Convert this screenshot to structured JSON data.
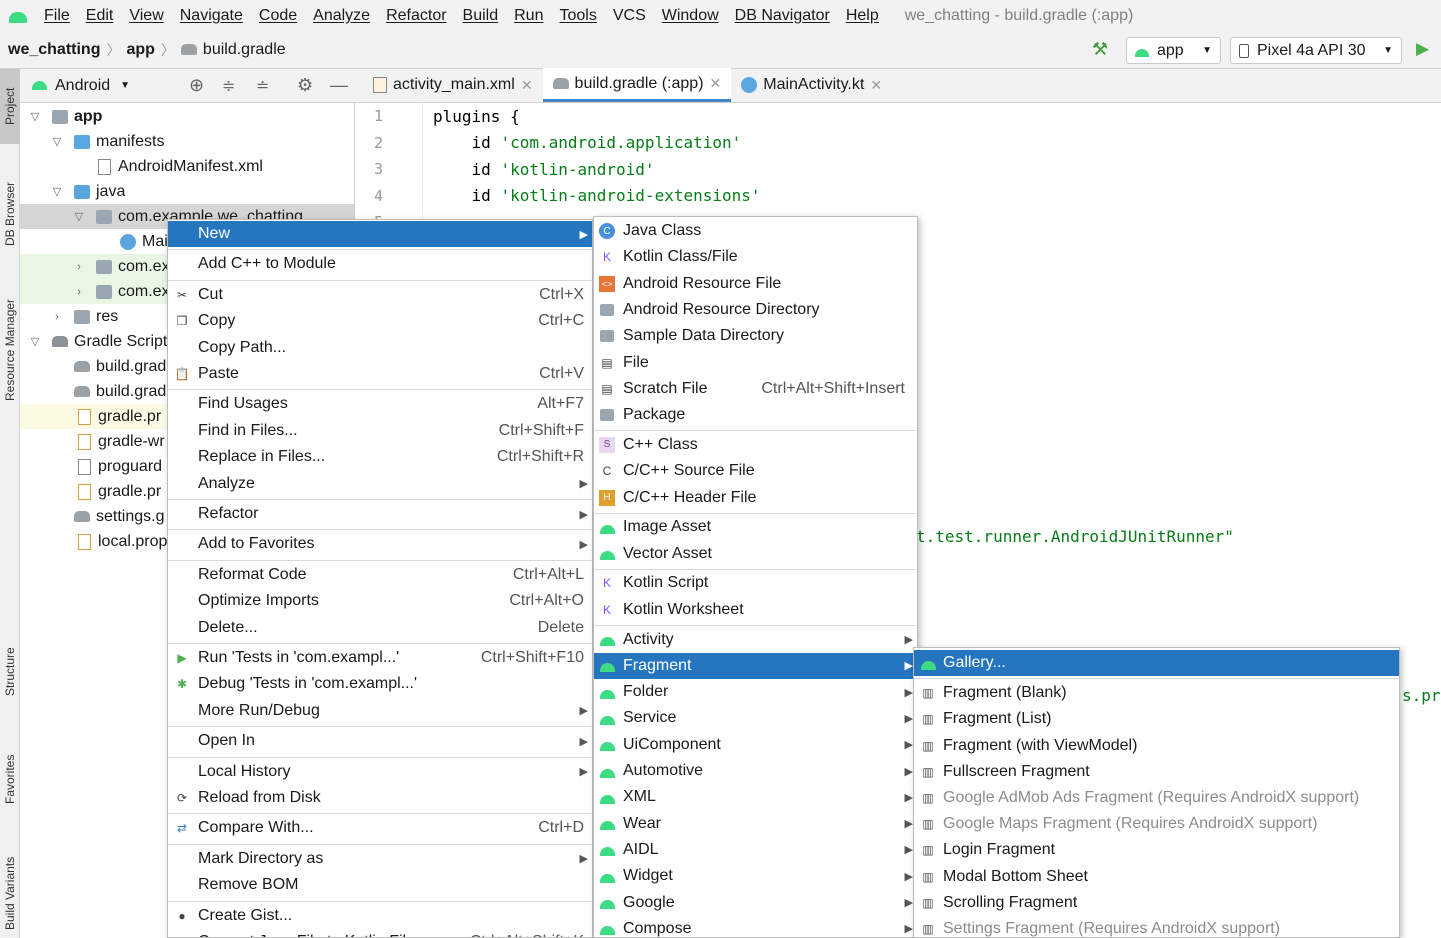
{
  "menubar": {
    "items": [
      "File",
      "Edit",
      "View",
      "Navigate",
      "Code",
      "Analyze",
      "Refactor",
      "Build",
      "Run",
      "Tools",
      "VCS",
      "Window",
      "DB Navigator",
      "Help"
    ],
    "window_title": "we_chatting - build.gradle (:app)"
  },
  "navbar": {
    "project": "we_chatting",
    "module": "app",
    "file": "build.gradle",
    "run_config": "app",
    "device": "Pixel 4a API 30"
  },
  "left_tool_windows": [
    "Project",
    "DB Browser",
    "Resource Manager",
    "Structure",
    "Favorites",
    "Build Variants"
  ],
  "project_panel": {
    "view_selector": "Android",
    "tree": [
      {
        "label": "app",
        "depth": 0,
        "arrow": "down",
        "bold": true
      },
      {
        "label": "manifests",
        "depth": 1,
        "arrow": "down"
      },
      {
        "label": "AndroidManifest.xml",
        "depth": 2,
        "arrow": ""
      },
      {
        "label": "java",
        "depth": 1,
        "arrow": "down"
      },
      {
        "label": "com.example.we_chatting",
        "depth": 2,
        "arrow": "down"
      },
      {
        "label": "Mai",
        "depth": 3,
        "arrow": ""
      },
      {
        "label": "com.ex",
        "depth": 2,
        "arrow": "right"
      },
      {
        "label": "com.ex",
        "depth": 2,
        "arrow": "right"
      },
      {
        "label": "res",
        "depth": 1,
        "arrow": "right"
      },
      {
        "label": "Gradle Script",
        "depth": 0,
        "arrow": "down"
      },
      {
        "label": "build.grad",
        "depth": 1,
        "arrow": ""
      },
      {
        "label": "build.grad",
        "depth": 1,
        "arrow": ""
      },
      {
        "label": "gradle.pr",
        "depth": 1,
        "arrow": ""
      },
      {
        "label": "gradle-wr",
        "depth": 1,
        "arrow": ""
      },
      {
        "label": "proguard",
        "depth": 1,
        "arrow": ""
      },
      {
        "label": "gradle.pr",
        "depth": 1,
        "arrow": ""
      },
      {
        "label": "settings.g",
        "depth": 1,
        "arrow": ""
      },
      {
        "label": "local.prop",
        "depth": 1,
        "arrow": ""
      }
    ]
  },
  "editor": {
    "tabs": [
      "activity_main.xml",
      "build.gradle (:app)",
      "MainActivity.kt"
    ],
    "active_tab": 1,
    "line_numbers": [
      "1",
      "2",
      "3",
      "4",
      "5"
    ],
    "lines": [
      {
        "kw": "plugins {",
        "str": ""
      },
      {
        "kw": "    id ",
        "str": "'com.android.application'"
      },
      {
        "kw": "    id ",
        "str": "'kotlin-android'"
      },
      {
        "kw": "    id ",
        "str": "'kotlin-android-extensions'"
      }
    ],
    "visible_fragment_1": "t.test.runner.AndroidJUnitRunner\"",
    "visible_fragment_2": "s.pr"
  },
  "context_menu": [
    {
      "label": "New",
      "submenu": true,
      "selected": true
    },
    {
      "sep": true
    },
    {
      "label": "Add C++ to Module"
    },
    {
      "sep": true
    },
    {
      "label": "Cut",
      "shortcut": "Ctrl+X",
      "icon": "scissors-icon"
    },
    {
      "label": "Copy",
      "shortcut": "Ctrl+C",
      "icon": "copy-icon"
    },
    {
      "label": "Copy Path..."
    },
    {
      "label": "Paste",
      "shortcut": "Ctrl+V",
      "icon": "paste-icon"
    },
    {
      "sep": true
    },
    {
      "label": "Find Usages",
      "shortcut": "Alt+F7"
    },
    {
      "label": "Find in Files...",
      "shortcut": "Ctrl+Shift+F"
    },
    {
      "label": "Replace in Files...",
      "shortcut": "Ctrl+Shift+R"
    },
    {
      "label": "Analyze",
      "submenu": true
    },
    {
      "sep": true
    },
    {
      "label": "Refactor",
      "submenu": true
    },
    {
      "sep": true
    },
    {
      "label": "Add to Favorites",
      "submenu": true
    },
    {
      "sep": true
    },
    {
      "label": "Reformat Code",
      "shortcut": "Ctrl+Alt+L"
    },
    {
      "label": "Optimize Imports",
      "shortcut": "Ctrl+Alt+O"
    },
    {
      "label": "Delete...",
      "shortcut": "Delete"
    },
    {
      "sep": true
    },
    {
      "label": "Run 'Tests in 'com.exampl...'",
      "shortcut": "Ctrl+Shift+F10",
      "icon": "run-icon"
    },
    {
      "label": "Debug 'Tests in 'com.exampl...'",
      "icon": "debug-icon"
    },
    {
      "label": "More Run/Debug",
      "submenu": true
    },
    {
      "sep": true
    },
    {
      "label": "Open In",
      "submenu": true
    },
    {
      "sep": true
    },
    {
      "label": "Local History",
      "submenu": true
    },
    {
      "label": "Reload from Disk",
      "icon": "reload-icon"
    },
    {
      "sep": true
    },
    {
      "label": "Compare With...",
      "shortcut": "Ctrl+D",
      "icon": "compare-icon"
    },
    {
      "sep": true
    },
    {
      "label": "Mark Directory as",
      "submenu": true
    },
    {
      "label": "Remove BOM"
    },
    {
      "sep": true
    },
    {
      "label": "Create Gist...",
      "icon": "github-icon"
    },
    {
      "label": "Convert Java File to Kotlin File",
      "shortcut": "Ctrl+Alt+Shift+K"
    }
  ],
  "new_submenu": [
    {
      "label": "Java Class",
      "icon": "java-class-icon"
    },
    {
      "label": "Kotlin Class/File",
      "icon": "kotlin-icon"
    },
    {
      "label": "Android Resource File",
      "icon": "android-resource-file-icon"
    },
    {
      "label": "Android Resource Directory",
      "icon": "folder-icon"
    },
    {
      "label": "Sample Data Directory",
      "icon": "folder-icon"
    },
    {
      "label": "File",
      "icon": "file-icon"
    },
    {
      "label": "Scratch File",
      "shortcut": "Ctrl+Alt+Shift+Insert",
      "icon": "scratch-file-icon"
    },
    {
      "label": "Package",
      "icon": "package-icon"
    },
    {
      "sep": true
    },
    {
      "label": "C++ Class",
      "icon": "cpp-class-icon"
    },
    {
      "label": "C/C++ Source File",
      "icon": "cpp-source-icon"
    },
    {
      "label": "C/C++ Header File",
      "icon": "cpp-header-icon"
    },
    {
      "sep": true
    },
    {
      "label": "Image Asset",
      "icon": "android-icon"
    },
    {
      "label": "Vector Asset",
      "icon": "android-icon"
    },
    {
      "sep": true
    },
    {
      "label": "Kotlin Script",
      "icon": "kotlin-script-icon"
    },
    {
      "label": "Kotlin Worksheet",
      "icon": "kotlin-script-icon"
    },
    {
      "sep": true
    },
    {
      "label": "Activity",
      "submenu": true,
      "icon": "android-icon"
    },
    {
      "label": "Fragment",
      "submenu": true,
      "selected": true,
      "icon": "android-icon"
    },
    {
      "label": "Folder",
      "submenu": true,
      "icon": "android-icon"
    },
    {
      "label": "Service",
      "submenu": true,
      "icon": "android-icon"
    },
    {
      "label": "UiComponent",
      "submenu": true,
      "icon": "android-icon"
    },
    {
      "label": "Automotive",
      "submenu": true,
      "icon": "android-icon"
    },
    {
      "label": "XML",
      "submenu": true,
      "icon": "android-icon"
    },
    {
      "label": "Wear",
      "submenu": true,
      "icon": "android-icon"
    },
    {
      "label": "AIDL",
      "submenu": true,
      "icon": "android-icon"
    },
    {
      "label": "Widget",
      "submenu": true,
      "icon": "android-icon"
    },
    {
      "label": "Google",
      "submenu": true,
      "icon": "android-icon"
    },
    {
      "label": "Compose",
      "submenu": true,
      "icon": "android-icon"
    }
  ],
  "fragment_submenu": [
    {
      "label": "Gallery...",
      "selected": true,
      "icon": "android-icon"
    },
    {
      "sep": true
    },
    {
      "label": "Fragment (Blank)",
      "icon": "fragment-icon"
    },
    {
      "label": "Fragment (List)",
      "icon": "fragment-icon"
    },
    {
      "label": "Fragment (with ViewModel)",
      "icon": "fragment-icon"
    },
    {
      "label": "Fullscreen Fragment",
      "icon": "fragment-icon"
    },
    {
      "label": "Google AdMob Ads Fragment (Requires AndroidX support)",
      "disabled": true,
      "icon": "fragment-icon"
    },
    {
      "label": "Google Maps Fragment (Requires AndroidX support)",
      "disabled": true,
      "icon": "fragment-icon"
    },
    {
      "label": "Login Fragment",
      "icon": "fragment-icon"
    },
    {
      "label": "Modal Bottom Sheet",
      "icon": "fragment-icon"
    },
    {
      "label": "Scrolling Fragment",
      "icon": "fragment-icon"
    },
    {
      "label": "Settings Fragment (Requires AndroidX support)",
      "disabled": true,
      "icon": "fragment-icon"
    }
  ],
  "colors": {
    "selection": "#2675bf",
    "android_green": "#3ddc84",
    "string_green": "#067d17",
    "tab_underline": "#4083c9"
  }
}
